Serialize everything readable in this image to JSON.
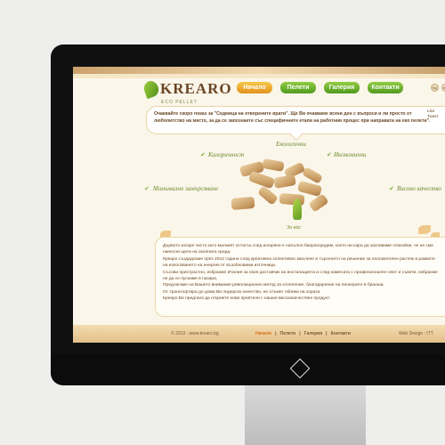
{
  "site": {
    "brand": "KREARO",
    "brand_sub": "ECO PELLET",
    "nav": [
      {
        "label": "Начало",
        "state": "active"
      },
      {
        "label": "Пелети",
        "state": "default"
      },
      {
        "label": "Галерия",
        "state": "default"
      },
      {
        "label": "Контакти",
        "state": "default"
      }
    ],
    "languages": [
      "bg",
      "en"
    ],
    "notice": "Очаквайте скоро показ за \"Седмица на отворените врати\". Ще Ви очакваме всеки ден с въпроси и ли просто от любопитство на място, за да се запознаете със специфичните етапи на работния процес при направата на еко пелети\".",
    "sidebox": [
      "Like",
      "Tweet"
    ],
    "features": {
      "top": "Екологични",
      "left1": "Калоричност",
      "right1": "Икономични",
      "left2": "Минимално замърсяване",
      "right2": "Високо качество",
      "bottom": "За нас"
    },
    "about": [
      "Дървото изгаря чисто като малкият остатък след изгаряне е напълно биоразградим, което ни кара да заспиваме спокойни, че не сме нанесли щети на околната среда.",
      "Креаро създадохме през 2012 година след креативно колективно мислене и търсенето на решение за положителен растеж в рамките на използването на енергия от възобновими източници.",
      "Съсови пристрастно, избрахме Италия за своя доставчик на инсталацията и след намесата с професионален опит и съвети, избрахме не да се пускаме в пазара.",
      "Предлагаме на Вашето внимание революционен метод за отопление, благодарение на пионерите в бранша.",
      "От транспортира до дома Ви лидерско качество, не отъмет облика на хората.",
      "Креаро Ви предлага да откриете нови приятели с нашия висококачествен продукт."
    ],
    "footer": {
      "copyright": "© 2013 - www.krearo.bg",
      "links": [
        "Начало",
        "Пелети",
        "Галерия",
        "Контакти"
      ],
      "credit": "Web Design : ITT"
    }
  }
}
